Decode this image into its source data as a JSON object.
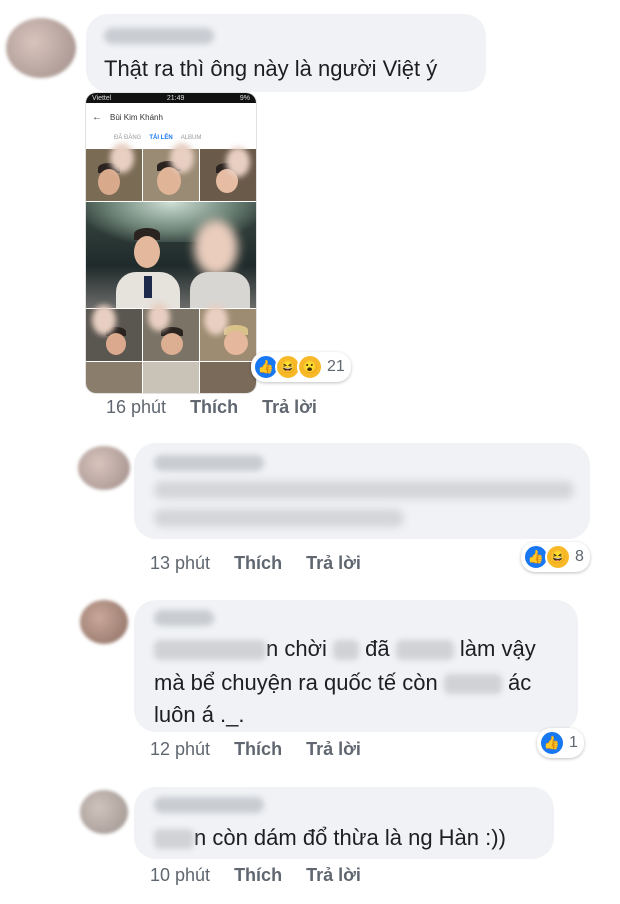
{
  "comments": [
    {
      "text": "Thật ra thì ông này là người Việt ý",
      "time": "16 phút",
      "like_label": "Thích",
      "reply_label": "Trả lời",
      "reaction_count": "21",
      "reactions": [
        "like-icon",
        "haha-icon",
        "wow-icon"
      ]
    },
    {
      "time": "13 phút",
      "like_label": "Thích",
      "reply_label": "Trả lời",
      "reaction_count": "8",
      "reactions": [
        "like-icon",
        "haha-icon"
      ]
    },
    {
      "line1_a": "",
      "line1_b": "n chời",
      "line1_c": "đã",
      "line1_d": "làm vậy",
      "line2_a": "mà bể chuyện ra quốc tế còn",
      "line2_b": "ác",
      "line3": "luôn á ._.",
      "time": "12 phút",
      "like_label": "Thích",
      "reply_label": "Trả lời",
      "reaction_count": "1",
      "reactions": [
        "like-icon"
      ]
    },
    {
      "text_tail": "n còn dám đổ thừa là ng Hàn :))",
      "time": "10 phút",
      "like_label": "Thích",
      "reply_label": "Trả lời"
    }
  ],
  "embedded_screenshot": {
    "status_left": "Viettel",
    "status_time": "21:49",
    "status_right": "9%",
    "profile_name": "Bùi Kim Khánh",
    "tabs": [
      "ĐÃ ĐĂNG",
      "TẢI LÊN",
      "ALBUM"
    ]
  },
  "colors": {
    "bubble": "#f0f2f5",
    "meta_text": "#606770",
    "like_blue": "#1877f2",
    "haha_yellow": "#f7b928"
  }
}
